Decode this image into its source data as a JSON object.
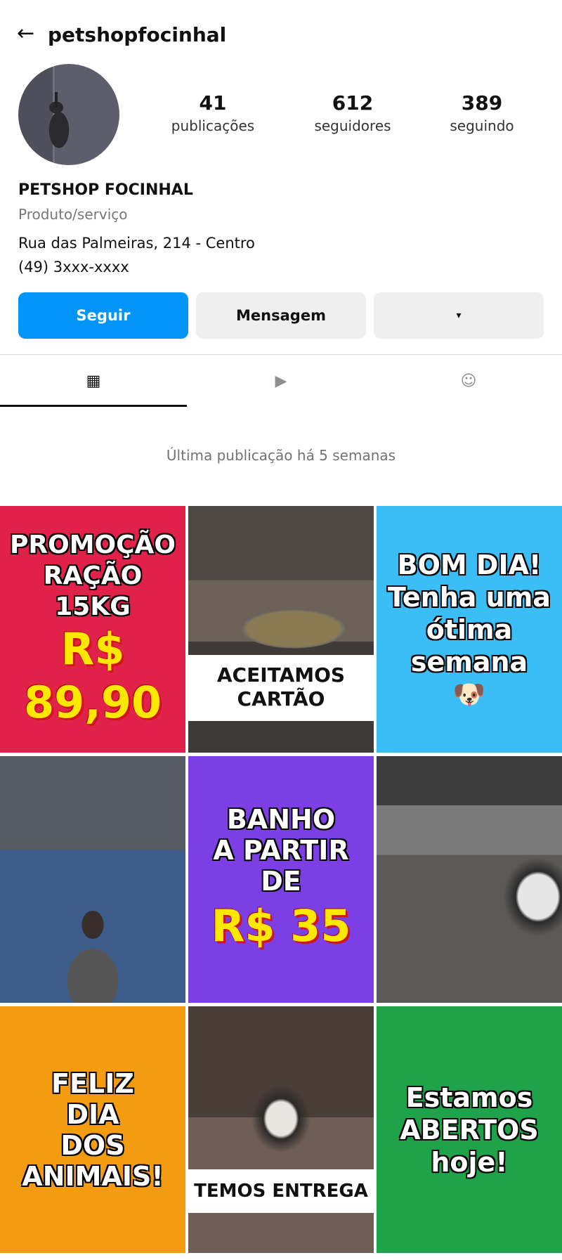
{
  "header": {
    "back_icon": "←",
    "username": "petshopfocinhal"
  },
  "profile": {
    "stats": [
      {
        "value": "41",
        "label": "publicações"
      },
      {
        "value": "612",
        "label": "seguidores"
      },
      {
        "value": "389",
        "label": "seguindo"
      }
    ],
    "name": "PETSHOP FOCINHAL",
    "category": "Produto/serviço",
    "address": "Rua das Palmeiras, 214 - Centro",
    "phone": "(49) 3xxx-xxxx"
  },
  "actions": {
    "follow": "Seguir",
    "message": "Mensagem",
    "more_icon": "▾"
  },
  "tabs": [
    {
      "icon": "▦",
      "name": "grid-icon"
    },
    {
      "icon": "▶",
      "name": "reels-icon"
    },
    {
      "icon": "☺",
      "name": "tagged-icon"
    }
  ],
  "feed": {
    "last_post": "Última publicação há 5 semanas",
    "posts": {
      "p1": {
        "line1": "PROMOÇÃO",
        "line2": "RAÇÃO",
        "line3": "15KG",
        "price1": "R$",
        "price2": "89,90",
        "bg": "#e0214a"
      },
      "p2": {
        "line1": "ACEITAMOS",
        "line2": "CARTÃO"
      },
      "p3": {
        "line1": "BOM DIA!",
        "line2": "Tenha uma",
        "line3": "ótima",
        "line4": "semana",
        "emoji": "🐶",
        "bg": "#3bbef5"
      },
      "p5": {
        "line1": "BANHO",
        "line2": "A PARTIR",
        "line3": "DE",
        "price": "R$ 35",
        "bg": "#7b3fe4"
      },
      "p7": {
        "line1": "FELIZ",
        "line2": "DIA",
        "line3": "DOS",
        "line4": "ANIMAIS!",
        "bg": "#f39c12"
      },
      "p8": {
        "line1": "TEMOS ENTREGA"
      },
      "p9": {
        "line1": "Estamos",
        "line2": "ABERTOS",
        "line3": "hoje!",
        "bg": "#1fa34a"
      }
    }
  },
  "colors": {
    "accent": "#0095f6",
    "button_secondary": "#efefef",
    "muted_text": "#737373"
  }
}
